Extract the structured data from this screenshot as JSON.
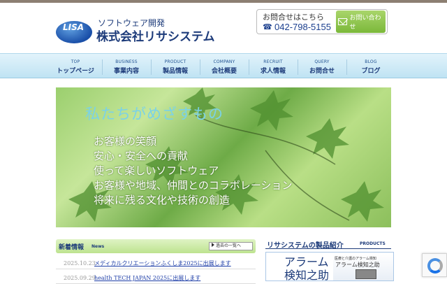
{
  "logo": {
    "text_dark": "L",
    "text_light": "ISA"
  },
  "header": {
    "tagline": "ソフトウェア開発",
    "company": "株式会社リサシステム",
    "contact_label": "お問合せはこちら",
    "phone": "042-798-5155",
    "mail_button": "お問い合わせ"
  },
  "nav": [
    {
      "en": "TOP",
      "jp": "トップページ"
    },
    {
      "en": "BUSINESS",
      "jp": "事業内容"
    },
    {
      "en": "PRODUCT",
      "jp": "製品情報"
    },
    {
      "en": "COMPANY",
      "jp": "会社概要"
    },
    {
      "en": "RECRUIT",
      "jp": "求人情報"
    },
    {
      "en": "QUERY",
      "jp": "お問合せ"
    },
    {
      "en": "BLOG",
      "jp": "ブログ"
    }
  ],
  "hero": {
    "title": "私たちがめざすもの",
    "lines": [
      "お客様の笑顔",
      "安心・安全への貢献",
      "使って楽しいソフトウェア",
      "お客様や地域、仲間とのコラボレーション",
      "将来に残る文化や技術の創造"
    ]
  },
  "news": {
    "title": "新着情報",
    "subtitle": "News",
    "more": "過去の一覧へ",
    "items": [
      {
        "date": "2025.10.23",
        "text": "メディカルクリエーションふくしま2025に出展します"
      },
      {
        "date": "2025.09.29",
        "text": "health TECH JAPAN 2025に出展します"
      }
    ]
  },
  "products": {
    "title": "リサシステムの製品紹介",
    "subtitle": "PRODUCTS",
    "banner_name_line1": "アラーム",
    "banner_name_line2": "検知之助",
    "banner_caption": "医療と介護のアラーム検知",
    "banner_product": "アラーム検知之助"
  },
  "colors": {
    "brand": "#1d3b7a",
    "nav_bg": "#cfe9f6",
    "news_bg": "#cfeaa8",
    "accent_green": "#7bb83a"
  }
}
